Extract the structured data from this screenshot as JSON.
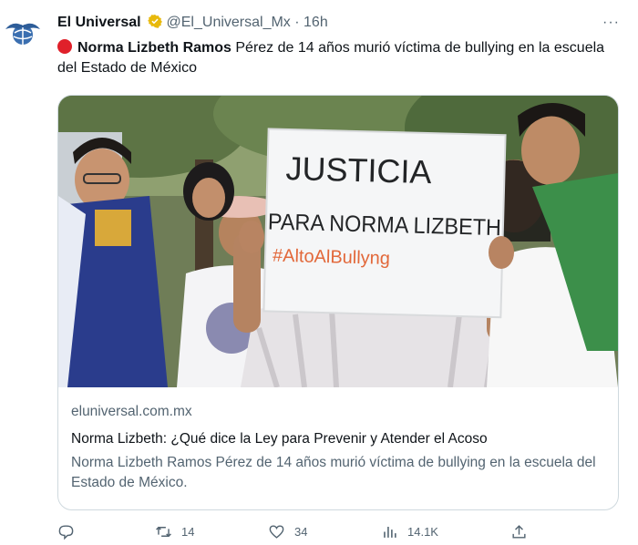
{
  "tweet": {
    "author_name": "El Universal",
    "handle": "@El_Universal_Mx",
    "separator": "·",
    "time": "16h",
    "more": "···",
    "text_bold": "Norma Lizbeth Ramos",
    "text_rest": " Pérez de 14 años murió víctima de bullying en la escuela del Estado de México"
  },
  "photo_sign": {
    "line1": "JUSTICIA",
    "line2": "PARA NORMA LIZBETH",
    "line3": "#AltoAlBullyng"
  },
  "card": {
    "domain": "eluniversal.com.mx",
    "title": "Norma Lizbeth: ¿Qué dice la Ley para Prevenir y Atender el Acoso",
    "description": "Norma Lizbeth Ramos Pérez de 14 años murió víctima de bullying en la escuela del Estado de México."
  },
  "actions": {
    "reply_count": "",
    "retweet_count": "14",
    "like_count": "34",
    "views_count": "14.1K"
  },
  "colors": {
    "accent": "#1d9bf0",
    "verified": "#e8b90c",
    "red_dot": "#e0202a",
    "muted": "#536471"
  }
}
